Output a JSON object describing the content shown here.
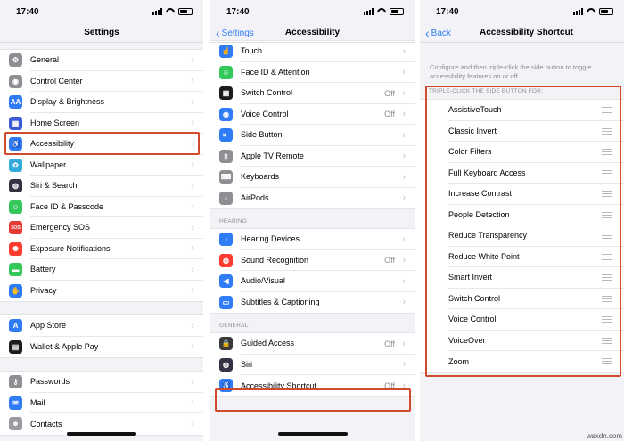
{
  "status": {
    "time": "17:40"
  },
  "screens": [
    {
      "title": "Settings",
      "groups": [
        [
          {
            "label": "General",
            "icon": "gear-icon",
            "color": "#8e8e93",
            "glyph": "⚙"
          },
          {
            "label": "Control Center",
            "icon": "control-center-icon",
            "color": "#8e8e93",
            "glyph": "◉"
          },
          {
            "label": "Display & Brightness",
            "icon": "display-icon",
            "color": "#2f7cf6",
            "glyph": "AA"
          },
          {
            "label": "Home Screen",
            "icon": "home-screen-icon",
            "color": "#3c5ad8",
            "glyph": "▦"
          },
          {
            "label": "Accessibility",
            "icon": "accessibility-icon",
            "color": "#2f7cf6",
            "glyph": "♿"
          },
          {
            "label": "Wallpaper",
            "icon": "wallpaper-icon",
            "color": "#34aadc",
            "glyph": "✿"
          },
          {
            "label": "Siri & Search",
            "icon": "siri-icon",
            "color": "#333344",
            "glyph": "◍"
          },
          {
            "label": "Face ID & Passcode",
            "icon": "face-id-icon",
            "color": "#34c759",
            "glyph": "☺"
          },
          {
            "label": "Emergency SOS",
            "icon": "sos-icon",
            "color": "#e53935",
            "glyph": "SOS"
          },
          {
            "label": "Exposure Notifications",
            "icon": "exposure-icon",
            "color": "#ff3b30",
            "glyph": "✺"
          },
          {
            "label": "Battery",
            "icon": "battery-icon",
            "color": "#34c759",
            "glyph": "▬"
          },
          {
            "label": "Privacy",
            "icon": "hand-icon",
            "color": "#2f7cf6",
            "glyph": "✋"
          }
        ],
        [
          {
            "label": "App Store",
            "icon": "app-store-icon",
            "color": "#2f7cf6",
            "glyph": "A"
          },
          {
            "label": "Wallet & Apple Pay",
            "icon": "wallet-icon",
            "color": "#1c1c1e",
            "glyph": "▤"
          }
        ],
        [
          {
            "label": "Passwords",
            "icon": "key-icon",
            "color": "#8e8e93",
            "glyph": "⚷"
          },
          {
            "label": "Mail",
            "icon": "mail-icon",
            "color": "#2f7cf6",
            "glyph": "✉"
          },
          {
            "label": "Contacts",
            "icon": "contacts-icon",
            "color": "#9a9aa0",
            "glyph": "☻"
          }
        ]
      ]
    },
    {
      "back": "Settings",
      "title": "Accessibility",
      "groups": [
        [
          {
            "label": "Touch",
            "icon": "touch-icon",
            "color": "#2f7cf6",
            "glyph": "☝"
          },
          {
            "label": "Face ID & Attention",
            "icon": "face-id-icon",
            "color": "#34c759",
            "glyph": "☺"
          },
          {
            "label": "Switch Control",
            "icon": "switch-control-icon",
            "color": "#1c1c1e",
            "glyph": "▦",
            "value": "Off"
          },
          {
            "label": "Voice Control",
            "icon": "voice-control-icon",
            "color": "#2f7cf6",
            "glyph": "◉",
            "value": "Off"
          },
          {
            "label": "Side Button",
            "icon": "side-button-icon",
            "color": "#2f7cf6",
            "glyph": "⇤"
          },
          {
            "label": "Apple TV Remote",
            "icon": "remote-icon",
            "color": "#8e8e93",
            "glyph": "▯"
          },
          {
            "label": "Keyboards",
            "icon": "keyboard-icon",
            "color": "#8e8e93",
            "glyph": "⌨"
          },
          {
            "label": "AirPods",
            "icon": "airpods-icon",
            "color": "#8e8e93",
            "glyph": "◖"
          }
        ]
      ],
      "sections": [
        {
          "header": "HEARING",
          "rows": [
            {
              "label": "Hearing Devices",
              "icon": "ear-icon",
              "color": "#2f7cf6",
              "glyph": "♪"
            },
            {
              "label": "Sound Recognition",
              "icon": "sound-recognition-icon",
              "color": "#ff3b30",
              "glyph": "◍",
              "value": "Off"
            },
            {
              "label": "Audio/Visual",
              "icon": "speaker-icon",
              "color": "#2f7cf6",
              "glyph": "◀"
            },
            {
              "label": "Subtitles & Captioning",
              "icon": "subtitles-icon",
              "color": "#2f7cf6",
              "glyph": "▭"
            }
          ]
        },
        {
          "header": "GENERAL",
          "rows": [
            {
              "label": "Guided Access",
              "icon": "lock-icon",
              "color": "#3a3a3c",
              "glyph": "🔒",
              "value": "Off"
            },
            {
              "label": "Siri",
              "icon": "siri-icon",
              "color": "#333344",
              "glyph": "◍"
            },
            {
              "label": "Accessibility Shortcut",
              "icon": "accessibility-icon",
              "color": "#2f7cf6",
              "glyph": "♿",
              "value": "Off"
            }
          ]
        }
      ]
    },
    {
      "back": "Back",
      "title": "Accessibility Shortcut",
      "description": "Configure and then triple-click the side button to toggle accessibility features on or off.",
      "section_header": "TRIPLE-CLICK THE SIDE BUTTON FOR:",
      "items": [
        "AssistiveTouch",
        "Classic Invert",
        "Color Filters",
        "Full Keyboard Access",
        "Increase Contrast",
        "People Detection",
        "Reduce Transparency",
        "Reduce White Point",
        "Smart Invert",
        "Switch Control",
        "Voice Control",
        "VoiceOver",
        "Zoom"
      ]
    }
  ],
  "watermark": "wsxdn.com",
  "highlight_color": "#d14a2b"
}
